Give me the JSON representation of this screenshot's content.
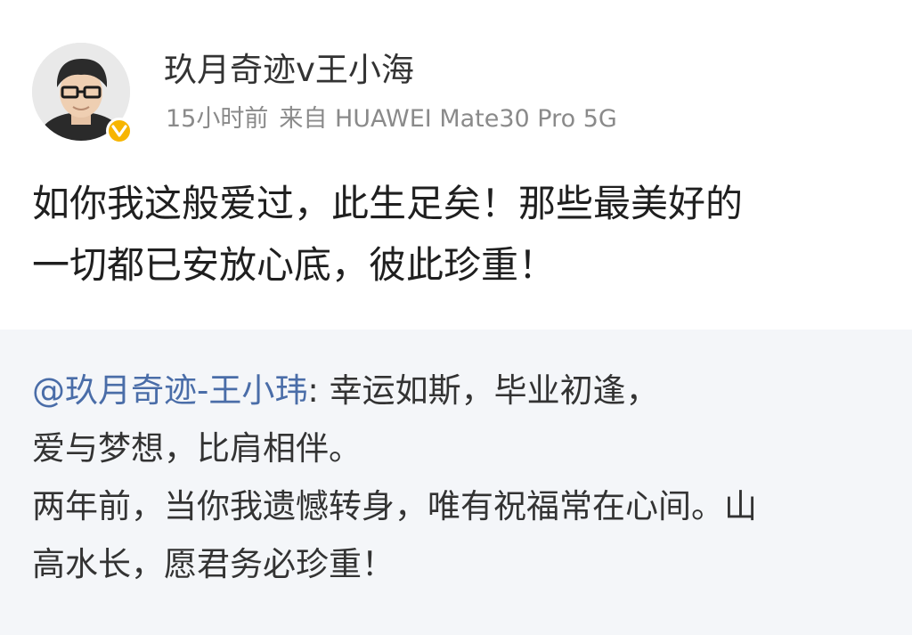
{
  "author": {
    "name": "玖月奇迹v王小海",
    "avatar_icon": "user-avatar-photo",
    "badge_icon": "verified-v-badge",
    "badge_color": "#f7b500"
  },
  "meta": {
    "time": "15小时前",
    "source_prefix": "来自",
    "device": "HUAWEI Mate30 Pro 5G"
  },
  "post": {
    "lines": [
      "如你我这般爱过，此生足矣！那些最美好的",
      "一切都已安放心底，彼此珍重！"
    ]
  },
  "repost": {
    "mention": "@玖月奇迹-王小玮",
    "lines": [
      ": 幸运如斯，毕业初逢，",
      "爱与梦想，比肩相伴。",
      "两年前，当你我遗憾转身，唯有祝福常在心间。山",
      "高水长，愿君务必珍重！"
    ],
    "mention_color": "#4a6da8"
  }
}
